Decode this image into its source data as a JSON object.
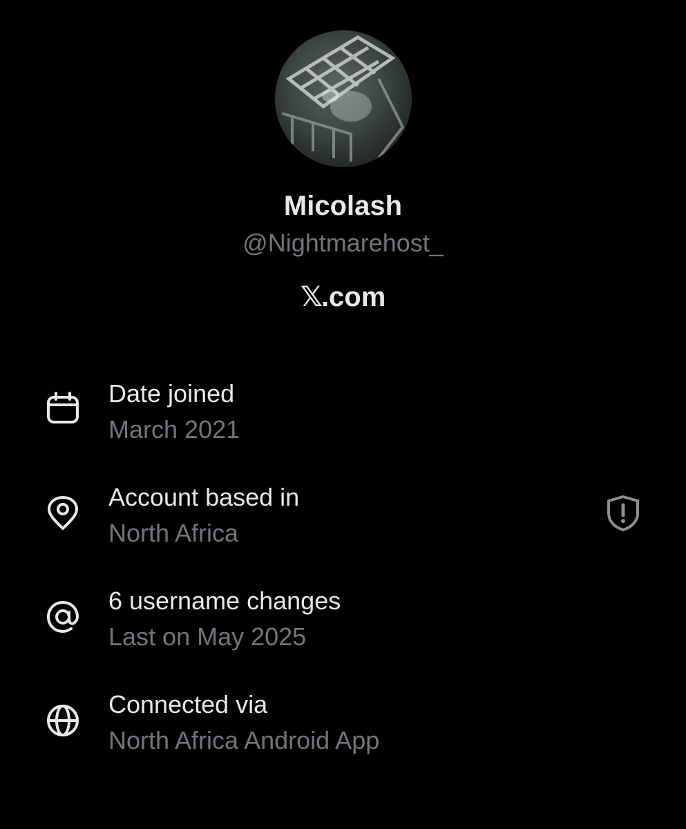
{
  "profile": {
    "display_name": "Micolash",
    "handle": "@Nightmarehost_",
    "site_suffix": ".com",
    "site_x": "𝕏"
  },
  "about": {
    "rows": [
      {
        "icon": "calendar-icon",
        "title": "Date joined",
        "value": "March 2021"
      },
      {
        "icon": "location-pin-icon",
        "title": "Account based in",
        "value": "North Africa"
      },
      {
        "icon": "at-sign-icon",
        "title": "6 username changes",
        "value": "Last on May 2025"
      },
      {
        "icon": "globe-icon",
        "title": "Connected via",
        "value": "North Africa Android App"
      }
    ],
    "warning_icon": "shield-exclamation-icon"
  },
  "colors": {
    "background": "#000000",
    "primary_text": "#e7e9ea",
    "secondary_text": "#71767b"
  }
}
